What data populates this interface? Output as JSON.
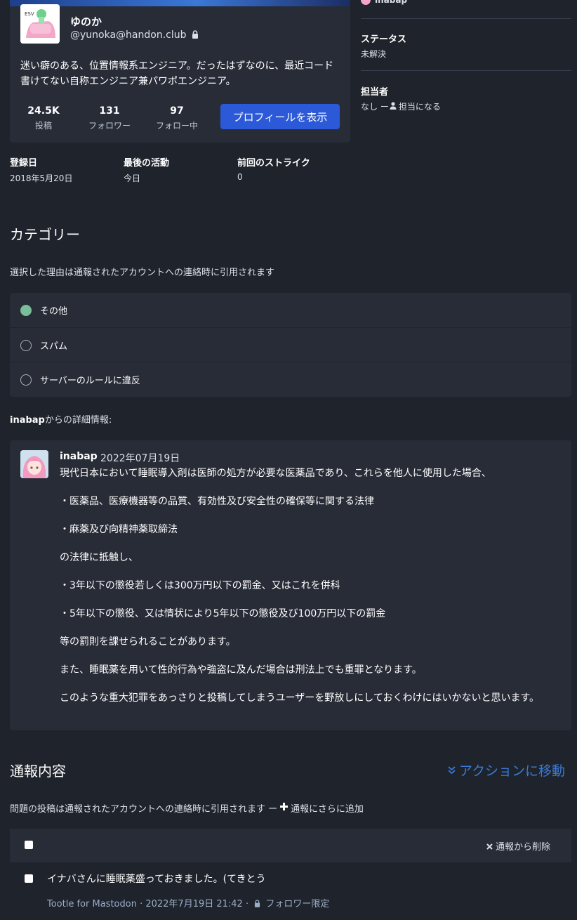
{
  "profile": {
    "display_name": "ゆのか",
    "acct": "@yunoka@handon.club",
    "bio": "迷い癖のある、位置情報系エンジニア。だったはずなのに、最近コード書けてない自称エンジニア兼パワポエンジニア。",
    "stats": [
      {
        "value": "24.5K",
        "label": "投稿"
      },
      {
        "value": "131",
        "label": "フォロワー"
      },
      {
        "value": "97",
        "label": "フォロー中"
      }
    ],
    "view_profile_label": "プロフィールを表示"
  },
  "sidebar": {
    "reporter_name": "inabap",
    "status_label": "ステータス",
    "status_value": "未解決",
    "assignee_label": "担当者",
    "assignee_value": "なし ー",
    "assign_me_label": "担当になる"
  },
  "account_meta": [
    {
      "label": "登録日",
      "value": "2018年5月20日"
    },
    {
      "label": "最後の活動",
      "value": "今日"
    },
    {
      "label": "前回のストライク",
      "value": "0"
    }
  ],
  "category": {
    "heading": "カテゴリー",
    "description": "選択した理由は通報されたアカウントへの連絡時に引用されます",
    "options": [
      {
        "label": "その他",
        "selected": true
      },
      {
        "label": "スパム",
        "selected": false
      },
      {
        "label": "サーバーのルールに違反",
        "selected": false
      }
    ]
  },
  "details": {
    "heading_user": "inabap",
    "heading_suffix": "からの詳細情報:",
    "username": "inabap",
    "date": "2022年07月19日",
    "paragraphs": [
      "現代日本において睡眠導入剤は医師の処方が必要な医薬品であり、これらを他人に使用した場合、",
      "・医薬品、医療機器等の品質、有効性及び安全性の確保等に関する法律",
      "・麻薬及び向精神薬取締法",
      "の法律に抵触し、",
      "・3年以下の懲役若しくは300万円以下の罰金、又はこれを併科",
      "・5年以下の懲役、又は情状により5年以下の懲役及び100万円以下の罰金",
      "等の罰則を課せられることがあります。",
      "また、睡眠薬を用いて性的行為や強盗に及んだ場合は刑法上でも重罪となります。",
      "このような重大犯罪をあっさりと投稿してしまうユーザーを野放しにしておくわけにはいかないと思います。"
    ]
  },
  "report": {
    "heading": "通報内容",
    "jump_label": "アクションに移動",
    "description": "問題の投稿は通報されたアカウントへの連絡時に引用されます ー",
    "add_label": "通報にさらに追加",
    "remove_label": "通報から削除",
    "status_text": "イナバさんに睡眠薬盛っておきました。(てきとう",
    "status_meta_prefix": "Tootle for Mastodon · 2022年7月19日 21:42 ·",
    "status_visibility": "フォロワー限定"
  },
  "colors": {
    "accent": "#2b59d8",
    "link": "#3a7ad8",
    "selected_radio": "#79bd9a",
    "background": "#1f232b",
    "panel": "#282c37"
  }
}
